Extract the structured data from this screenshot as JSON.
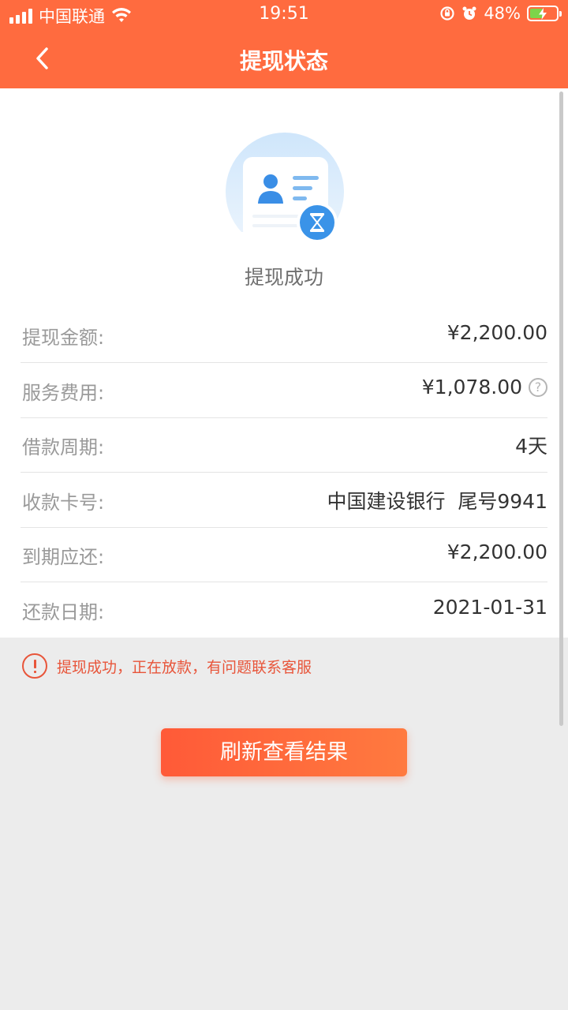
{
  "status_bar": {
    "carrier": "中国联通",
    "time": "19:51",
    "battery": "48%"
  },
  "nav": {
    "title": "提现状态"
  },
  "status": {
    "text": "提现成功"
  },
  "details": [
    {
      "label": "提现金额:",
      "value": "¥2,200.00"
    },
    {
      "label": "服务费用:",
      "value": "¥1,078.00"
    },
    {
      "label": "借款周期:",
      "value": "4天"
    },
    {
      "label": "收款卡号:",
      "value": "中国建设银行  尾号9941"
    },
    {
      "label": "到期应还:",
      "value": "¥2,200.00"
    },
    {
      "label": "还款日期:",
      "value": "2021-01-31"
    }
  ],
  "notice": {
    "text": "提现成功，正在放款，有问题联系客服"
  },
  "refresh_button": {
    "label": "刷新查看结果"
  },
  "colors": {
    "header": "#ff6b3f",
    "accent": "#e8553a",
    "battery_fill": "#7dd44a"
  },
  "icons": {
    "back": "chevron-left-icon",
    "wifi": "wifi-icon",
    "status_illustration": "id-card-hourglass-icon",
    "help": "question-circle-icon",
    "notice": "info-circle-icon"
  }
}
